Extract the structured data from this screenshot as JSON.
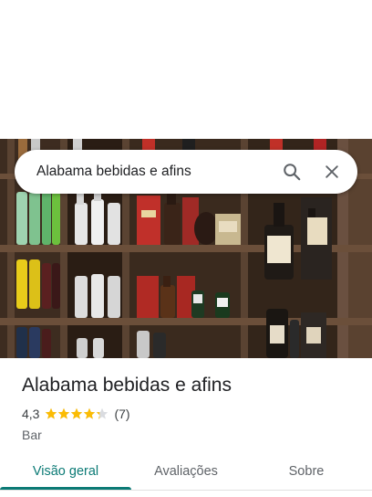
{
  "search": {
    "query": "Alabama bebidas e afins",
    "search_icon": "search-icon",
    "close_icon": "close-icon"
  },
  "hero": {
    "photo": "liquor-store-shelves-photo"
  },
  "place": {
    "name": "Alabama bebidas e afins",
    "rating": "4,3",
    "rating_value": 4.3,
    "stars_max": 5,
    "reviews": "(7)",
    "category": "Bar",
    "star_color": "#fbbc04"
  },
  "tabs": [
    {
      "label": "Visão geral",
      "active": true
    },
    {
      "label": "Avaliações",
      "active": false
    },
    {
      "label": "Sobre",
      "active": false
    }
  ],
  "colors": {
    "accent": "#0b7a75",
    "shelf_wood": "#4a3526"
  }
}
